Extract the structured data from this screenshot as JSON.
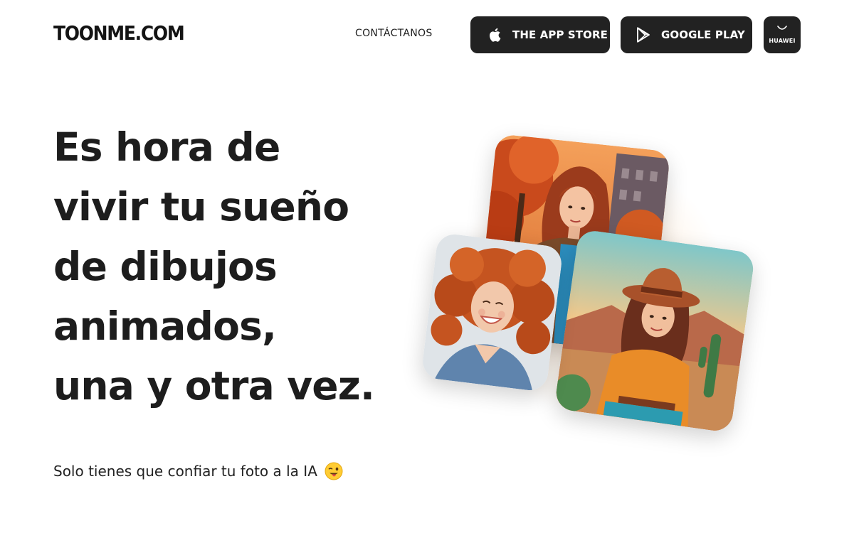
{
  "header": {
    "logo": "TOONME.COM",
    "contact_label": "CONTÁCTANOS",
    "app_store": {
      "label": "THE APP STORE",
      "icon": "apple-icon"
    },
    "google_play": {
      "label": "GOOGLE PLAY",
      "icon": "google-play-icon"
    },
    "huawei": {
      "label": "HUAWEI",
      "icon": "huawei-appgallery-icon"
    }
  },
  "hero": {
    "headline_lines": [
      "Es hora de",
      "vivir tu sueño",
      "de dibujos",
      "animados,",
      "una y otra vez."
    ],
    "subline": "Solo tienes que confiar tu foto a la IA",
    "emoji": "winking-tongue-emoji"
  },
  "collage": {
    "cards": [
      {
        "name": "cartoon-woman-autumn-city"
      },
      {
        "name": "cartoon-woman-desert-hat"
      },
      {
        "name": "photo-woman-curly-red-hair"
      }
    ]
  },
  "colors": {
    "button_bg": "#222222",
    "text": "#1d1d1d",
    "glow": "#ffbe78"
  }
}
